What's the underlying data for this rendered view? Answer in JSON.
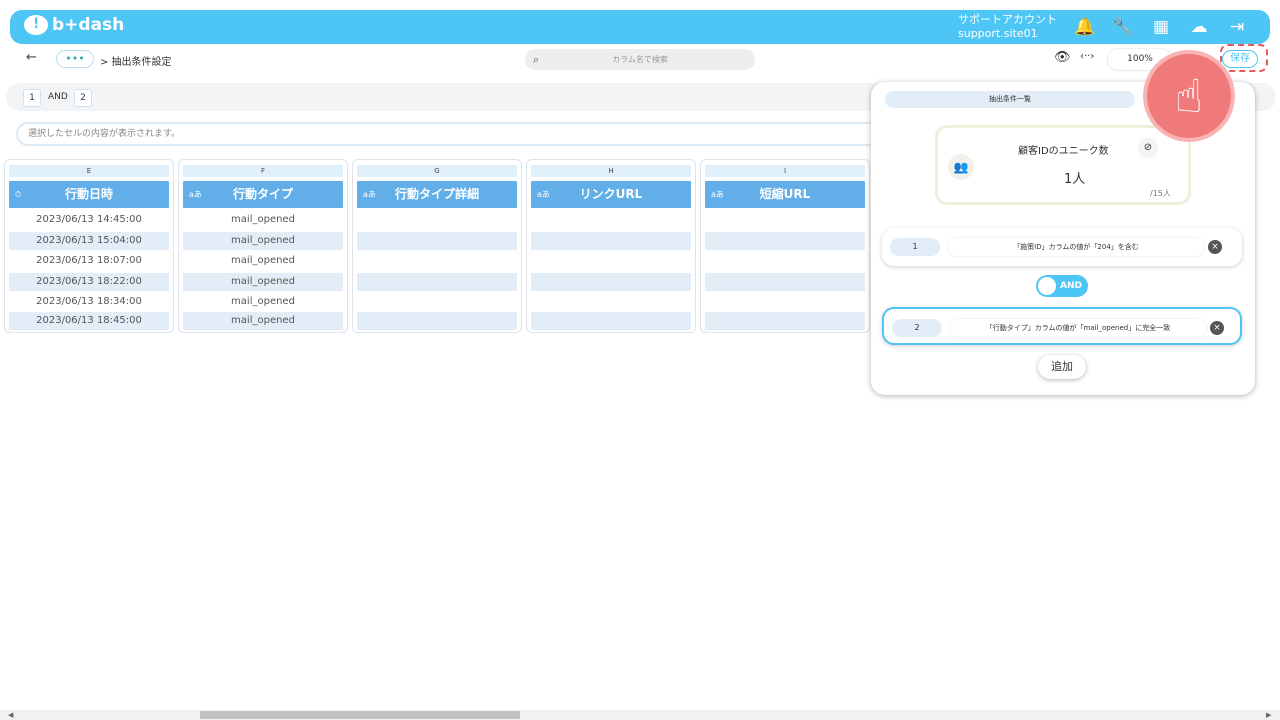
{
  "header": {
    "logo": "b+dash",
    "account_name": "サポートアカウント",
    "account_id": "support.site01",
    "icons": [
      "bell-icon",
      "wrench-icon",
      "grid-icon",
      "chat-icon",
      "logout-icon"
    ]
  },
  "toolbar": {
    "back": "←",
    "more": "•••",
    "breadcrumb": "> 抽出条件設定",
    "search_placeholder": "カラム名で検索",
    "zoom": "100%",
    "save": "保存"
  },
  "conditions_bar": {
    "chip1": "1",
    "op": "AND",
    "chip2": "2"
  },
  "cell_info": "選択したセルの内容が表示されます。",
  "columns": [
    {
      "letter": "E",
      "name": "行動日時",
      "type_icon": "⏱",
      "cells": [
        "2023/06/13 14:45:00",
        "2023/06/13 15:04:00",
        "2023/06/13 18:07:00",
        "2023/06/13 18:22:00",
        "2023/06/13 18:34:00",
        "2023/06/13 18:45:00"
      ]
    },
    {
      "letter": "F",
      "name": "行動タイプ",
      "type_icon": "aあ",
      "cells": [
        "mail_opened",
        "mail_opened",
        "mail_opened",
        "mail_opened",
        "mail_opened",
        "mail_opened"
      ]
    },
    {
      "letter": "G",
      "name": "行動タイプ詳細",
      "type_icon": "aあ",
      "cells": [
        "",
        "",
        "",
        "",
        "",
        ""
      ]
    },
    {
      "letter": "H",
      "name": "リンクURL",
      "type_icon": "aあ",
      "cells": [
        "",
        "",
        "",
        "",
        "",
        ""
      ]
    },
    {
      "letter": "I",
      "name": "短縮URL",
      "type_icon": "aあ",
      "cells": [
        "",
        "",
        "",
        "",
        "",
        ""
      ]
    }
  ],
  "panel": {
    "tab": "抽出条件一覧",
    "unique_title": "顧客IDのユニーク数",
    "unique_count": "1人",
    "unique_total": "/15人",
    "conditions": [
      {
        "num": "1",
        "text": "「施策ID」カラムの値が「204」を含む"
      },
      {
        "num": "2",
        "text": "「行動タイプ」カラムの値が「mail_opened」に完全一致"
      }
    ],
    "and_label": "AND",
    "add_label": "追加"
  }
}
